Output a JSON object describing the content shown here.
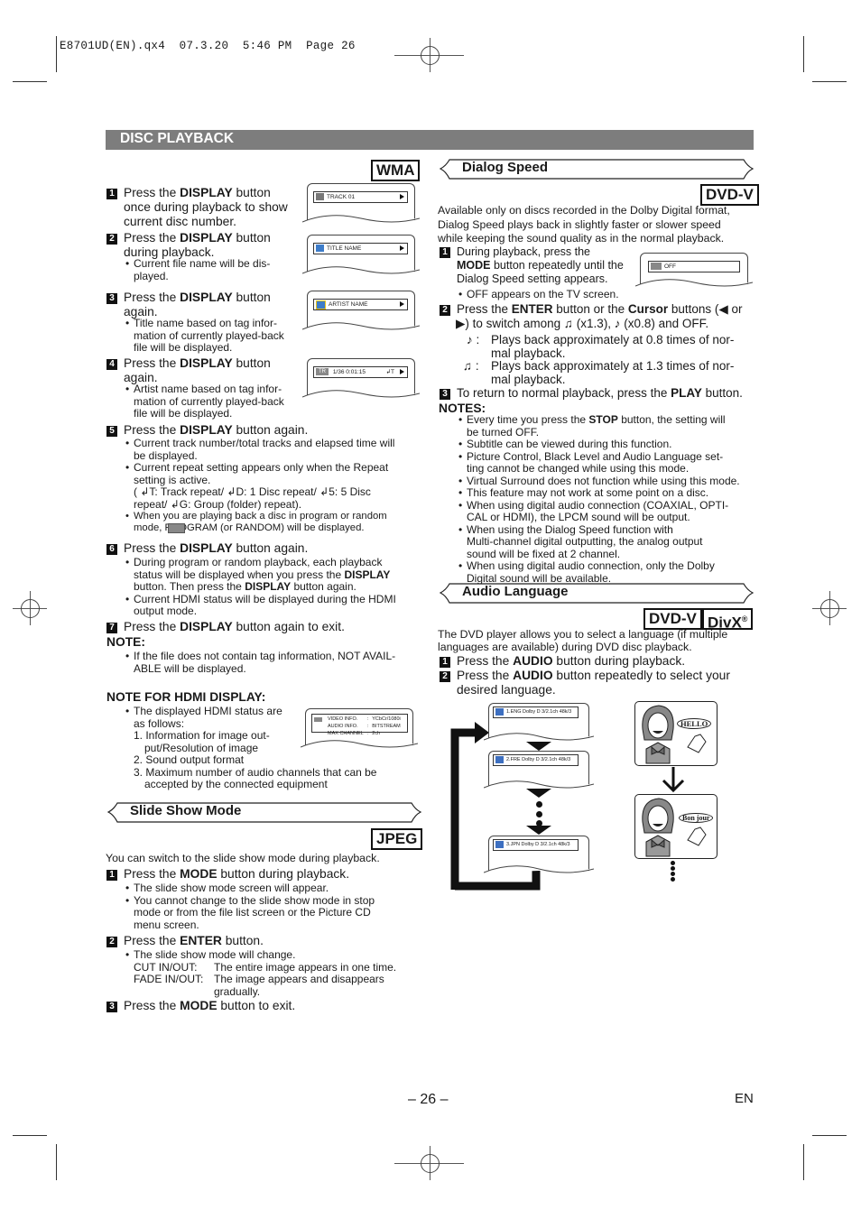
{
  "slug": {
    "file": "E8701UD(EN).qx4",
    "date": "07.3.20",
    "time": "5:46 PM",
    "page": "Page 26"
  },
  "section_title": "DISC PLAYBACK",
  "left": {
    "badge_wma": "WMA",
    "steps": [
      {
        "num": "1",
        "pre": "Press the ",
        "bold": "DISPLAY",
        "post": " button",
        "line2": "once during playback to show",
        "line3": "current disc number."
      },
      {
        "num": "2",
        "pre": "Press the ",
        "bold": "DISPLAY",
        "post": " button",
        "line2": "during playback.",
        "bullets": [
          "Current file name will be dis-",
          "played."
        ]
      },
      {
        "num": "3",
        "pre": "Press the ",
        "bold": "DISPLAY",
        "post": " button",
        "line2": "again.",
        "bullets": [
          "Title name based on tag infor-",
          "mation of currently played-back",
          "file will be displayed."
        ]
      },
      {
        "num": "4",
        "pre": "Press the ",
        "bold": "DISPLAY",
        "post": " button",
        "line2": "again.",
        "bullets": [
          "Artist name based on tag infor-",
          "mation of currently played-back",
          "file will be displayed."
        ]
      },
      {
        "num": "5",
        "pre": "Press the ",
        "bold": "DISPLAY",
        "post": " button again."
      },
      {
        "num": "6",
        "pre": "Press the ",
        "bold": "DISPLAY",
        "post": " button again."
      },
      {
        "num": "7",
        "pre": "Press the ",
        "bold": "DISPLAY",
        "post": " button again to exit."
      }
    ],
    "step5_bullets": {
      "b1": [
        "Current track number/total tracks and elapsed time will",
        "be displayed."
      ],
      "b2": [
        "Current repeat setting appears only when the Repeat",
        "setting is active.",
        "( ↲T: Track repeat/  ↲D: 1 Disc repeat/  ↲5: 5 Disc",
        "repeat/  ↲G: Group (folder) repeat)."
      ],
      "b3": [
        "When you are playing back a disc in program or random",
        "mode,        PROGRAM (or RANDOM) will be displayed."
      ]
    },
    "step6_bullets": {
      "b1_pre": "During program or random playback, each playback",
      "b1_l2_pre": "status will be displayed when you press the ",
      "b1_l2_bold": "DISPLAY",
      "b1_l3_pre": "button. Then press the ",
      "b1_l3_bold": "DISPLAY",
      "b1_l3_post": " button again.",
      "b2": [
        "Current HDMI status will be displayed during the HDMI",
        "output mode."
      ]
    },
    "note_title": "NOTE:",
    "note": [
      "If the file does not contain tag information, NOT AVAIL-",
      "ABLE will be displayed."
    ],
    "hdmi_note_title": "NOTE FOR HDMI DISPLAY:",
    "hdmi_intro": [
      "The displayed HDMI status are",
      "as follows:"
    ],
    "hdmi_list": [
      "1. Information for image out-",
      "put/Resolution of image",
      "2. Sound output format",
      "3. Maximum number of audio channels that can be",
      "accepted by the connected equipment"
    ],
    "screens": {
      "track": "TRACK 01",
      "title": "TITLE NAME",
      "artist": "ARTIST NAME",
      "status_icon": "TR",
      "status": "1/36   0:01:15",
      "status_repeat": "↲T",
      "hdmi_rows": [
        [
          "VIDEO INFO.",
          ":",
          "YCbCr/1080i"
        ],
        [
          "AUDIO INFO.",
          ":",
          "BITSTREAM"
        ],
        [
          "MAX CHANNEL",
          ":",
          "2ch"
        ]
      ]
    },
    "slideshow": {
      "title": "Slide Show Mode",
      "badge": "JPEG",
      "intro": "You can switch to the slide show mode during playback.",
      "s1_pre": "Press the ",
      "s1_bold": "MODE",
      "s1_post": " button during playback.",
      "s1_bullets": [
        "The slide show mode screen will appear.",
        "You cannot change to the slide show mode in stop",
        "mode or from the file list screen or the Picture CD",
        "menu screen."
      ],
      "s2_pre": "Press the ",
      "s2_bold": "ENTER",
      "s2_post": " button.",
      "s2_bullet": "The slide show mode will change.",
      "cut_label": "CUT IN/OUT:",
      "cut_desc": "The entire image appears in one time.",
      "fade_label": "FADE IN/OUT:",
      "fade_desc": "The image appears and disappears",
      "fade_desc2": "gradually.",
      "s3_pre": "Press the ",
      "s3_bold": "MODE",
      "s3_post": " button to exit."
    }
  },
  "right": {
    "dialog": {
      "title": "Dialog Speed",
      "badge": "DVD-V",
      "intro": [
        "Available only on discs recorded in the Dolby Digital format,",
        "Dialog Speed plays back in slightly faster or slower speed",
        "while keeping the sound quality as in the normal playback."
      ],
      "s1_l1": "During playback, press the",
      "s1_bold": "MODE",
      "s1_l2": " button repeatedly until the",
      "s1_l3": "Dialog Speed setting appears.",
      "s1_bullet": "OFF appears on the TV screen.",
      "screen_off": "OFF",
      "s2_pre": "Press the ",
      "s2_b1": "ENTER",
      "s2_mid": " button or the ",
      "s2_b2": "Cursor",
      "s2_post": " buttons (◀ or",
      "s2_l2": "▶) to switch among  ♫  (x1.3),  ♪  (x0.8) and OFF.",
      "slow_sym": "♪ :",
      "slow": [
        "Plays back approximately at 0.8 times of nor-",
        "mal playback."
      ],
      "fast_sym": "♫ :",
      "fast": [
        "Plays back approximately at 1.3 times of nor-",
        "mal playback."
      ],
      "s3_pre": "To return to normal playback, press the ",
      "s3_bold": "PLAY",
      "s3_post": " button.",
      "notes_title": "NOTES:",
      "n1_pre": "Every time you press the ",
      "n1_bold": "STOP",
      "n1_post": " button, the setting will",
      "n1_l2": "be turned OFF.",
      "notes": [
        [
          "Subtitle can be viewed during this function."
        ],
        [
          "Picture Control, Black Level and Audio Language set-",
          "ting cannot be changed while using this mode."
        ],
        [
          "Virtual Surround does not function while using this mode."
        ],
        [
          "This feature may not work at some point on a disc."
        ],
        [
          "When using digital audio connection (COAXIAL, OPTI-",
          "CAL or HDMI), the LPCM sound will be output."
        ],
        [
          "When using the Dialog Speed function with",
          "Multi-channel digital outputting, the analog output",
          "sound will be fixed at 2 channel."
        ],
        [
          "When using digital audio connection, only the Dolby",
          "Digital sound will be available."
        ]
      ]
    },
    "audio": {
      "title": "Audio Language",
      "badge1": "DVD-V",
      "badge2": "DivX",
      "badge2_reg": "®",
      "intro": [
        "The DVD player allows you to select a language (if multiple",
        "languages are available) during DVD disc playback."
      ],
      "s1_pre": "Press the ",
      "s1_bold": "AUDIO",
      "s1_post": " button during playback.",
      "s2_pre": "Press the ",
      "s2_bold": "AUDIO",
      "s2_post": " button repeatedly to select your",
      "s2_l2": "desired language.",
      "osd": [
        "1.ENG Dolby D 3/2.1ch 48k/3",
        "2.FRE Dolby D 3/2.1ch 48k/3",
        "3.JPN Dolby D 3/2.1ch 48k/3"
      ],
      "bubble1": "HELLO",
      "bubble2": "Bon jour"
    }
  },
  "footer": {
    "page": "– 26 –",
    "lang": "EN"
  }
}
